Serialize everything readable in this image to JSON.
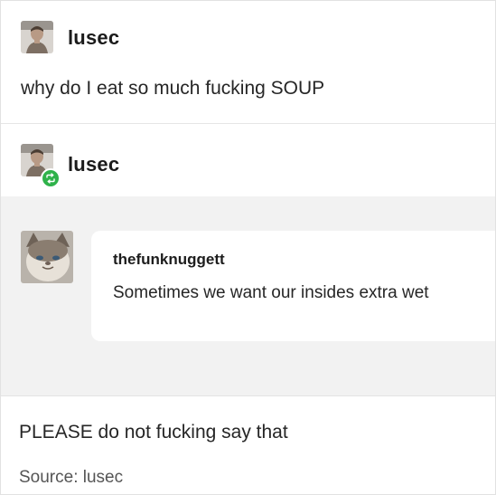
{
  "post": {
    "op": {
      "username": "lusec",
      "text": "why do I eat so much fucking SOUP"
    },
    "reblog": {
      "username": "lusec",
      "badge_icon": "reblog-icon",
      "badge_color": "#2fb24a"
    },
    "quote": {
      "username": "thefunknuggett",
      "text": "Sometimes we want our insides extra wet"
    },
    "reply": {
      "text": "PLEASE do not fucking say that"
    },
    "source": {
      "label": "Source:",
      "value": "lusec"
    }
  }
}
